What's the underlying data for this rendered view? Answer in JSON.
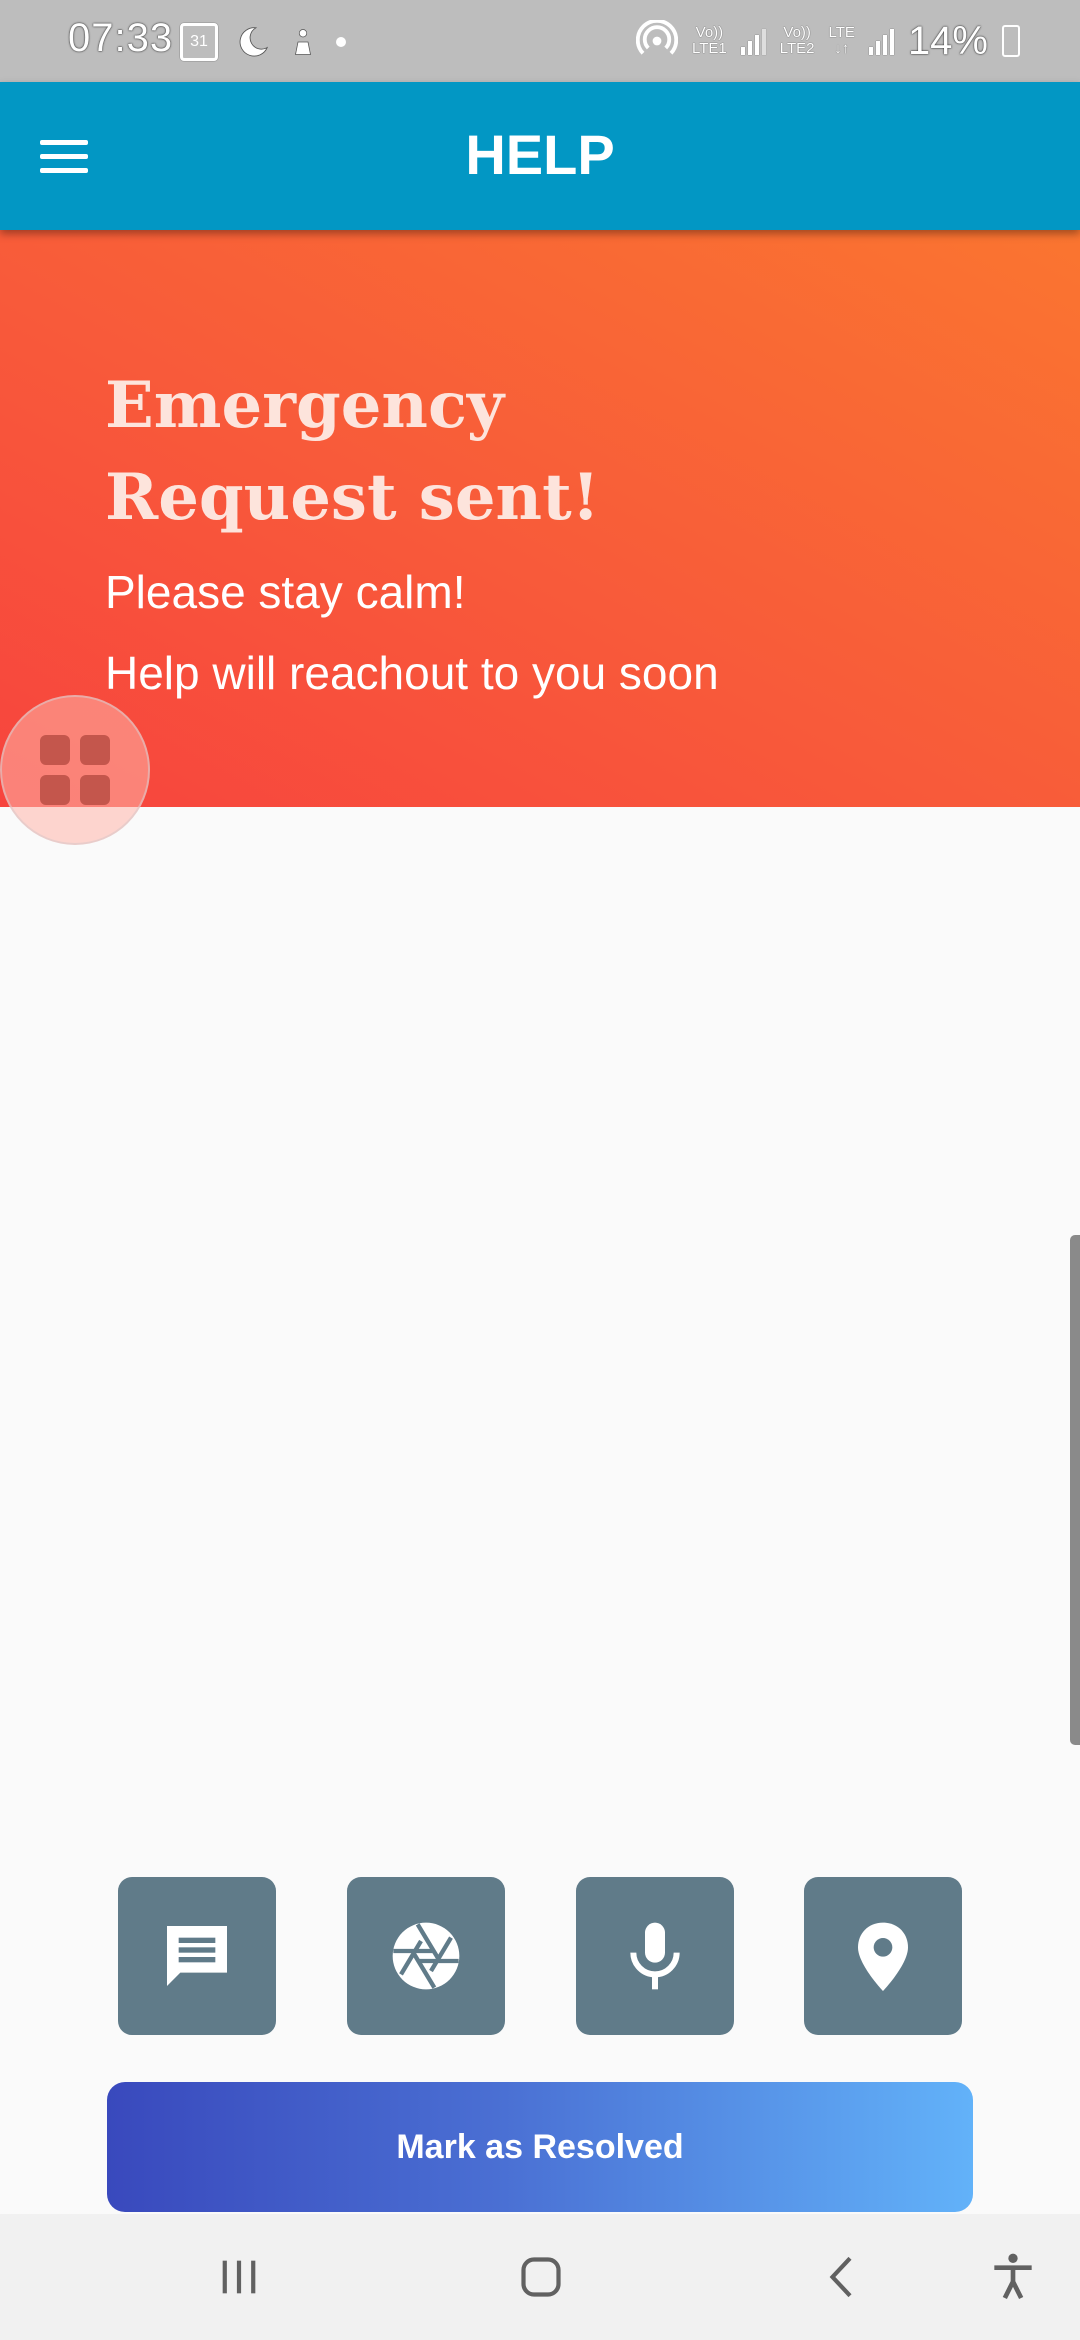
{
  "status_bar": {
    "time": "07:33",
    "calendar_day": "31",
    "sim1_top": "Vo))",
    "sim1_bottom": "LTE1",
    "sim2_top": "Vo))",
    "sim2_bottom": "LTE2",
    "data_label": "LTE",
    "battery": "14%"
  },
  "app_bar": {
    "title": "HELP",
    "menu_icon": "hamburger-menu-icon"
  },
  "banner": {
    "heading": "Emergency Request sent!",
    "line1": "Please stay calm!",
    "line2": "Help will reachout to you soon",
    "gradient_start": "#f7443e",
    "gradient_end": "#fa7530"
  },
  "assistive_button": {
    "icon": "grid-icon"
  },
  "actions": [
    {
      "name": "message",
      "icon": "message-icon"
    },
    {
      "name": "camera",
      "icon": "camera-aperture-icon"
    },
    {
      "name": "microphone",
      "icon": "microphone-icon"
    },
    {
      "name": "location",
      "icon": "location-pin-icon"
    }
  ],
  "action_color": "#607b89",
  "resolve_button": {
    "label": "Mark as Resolved",
    "gradient_start": "#3949bd",
    "gradient_end": "#62b2f9"
  },
  "nav_bar": {
    "items": [
      "recents-icon",
      "home-icon",
      "back-icon",
      "accessibility-icon"
    ]
  },
  "colors": {
    "app_bar": "#0297c4",
    "background": "#fafafa"
  }
}
